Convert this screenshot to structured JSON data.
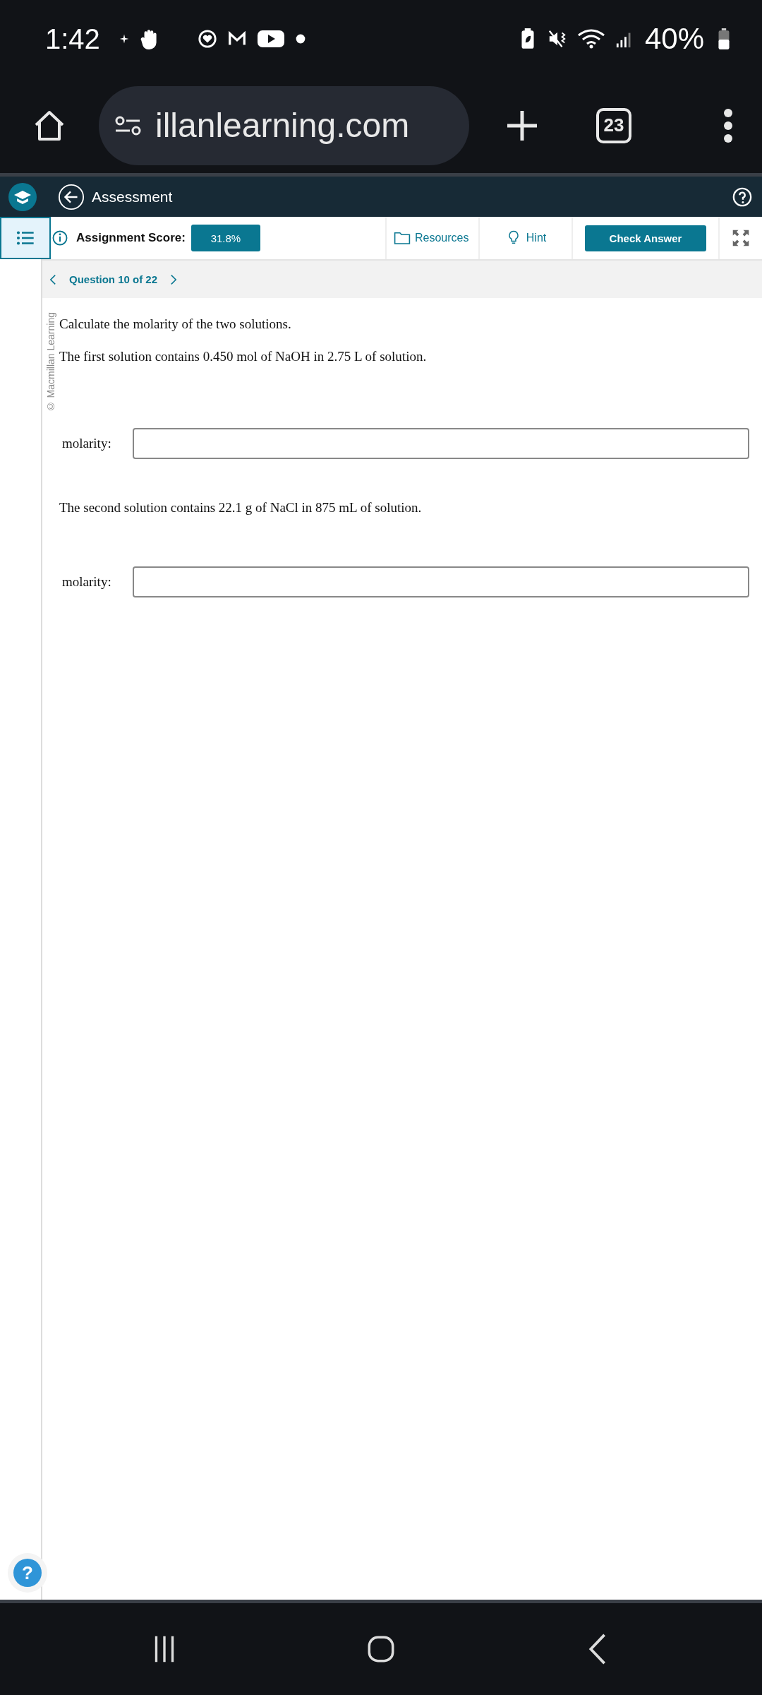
{
  "status_bar": {
    "time": "1:42",
    "battery": "40%"
  },
  "browser": {
    "url": "illanlearning.com",
    "tab_count": "23"
  },
  "header": {
    "title": "Assessment"
  },
  "toolbar": {
    "score_label": "Assignment Score:",
    "score": "31.8%",
    "resources": "Resources",
    "hint": "Hint",
    "check_answer": "Check Answer"
  },
  "question_nav": {
    "label": "Question 10 of 22"
  },
  "copyright": "© Macmillan Learning",
  "question": {
    "prompt": "Calculate the molarity of the two solutions.",
    "parts": [
      {
        "text": "The first solution contains 0.450 mol of NaOH in 2.75 L of solution.",
        "field_label": "molarity:"
      },
      {
        "text": "The second solution contains 22.1 g of NaCl in 875 mL of solution.",
        "field_label": "molarity:"
      }
    ]
  },
  "help_button": "?"
}
